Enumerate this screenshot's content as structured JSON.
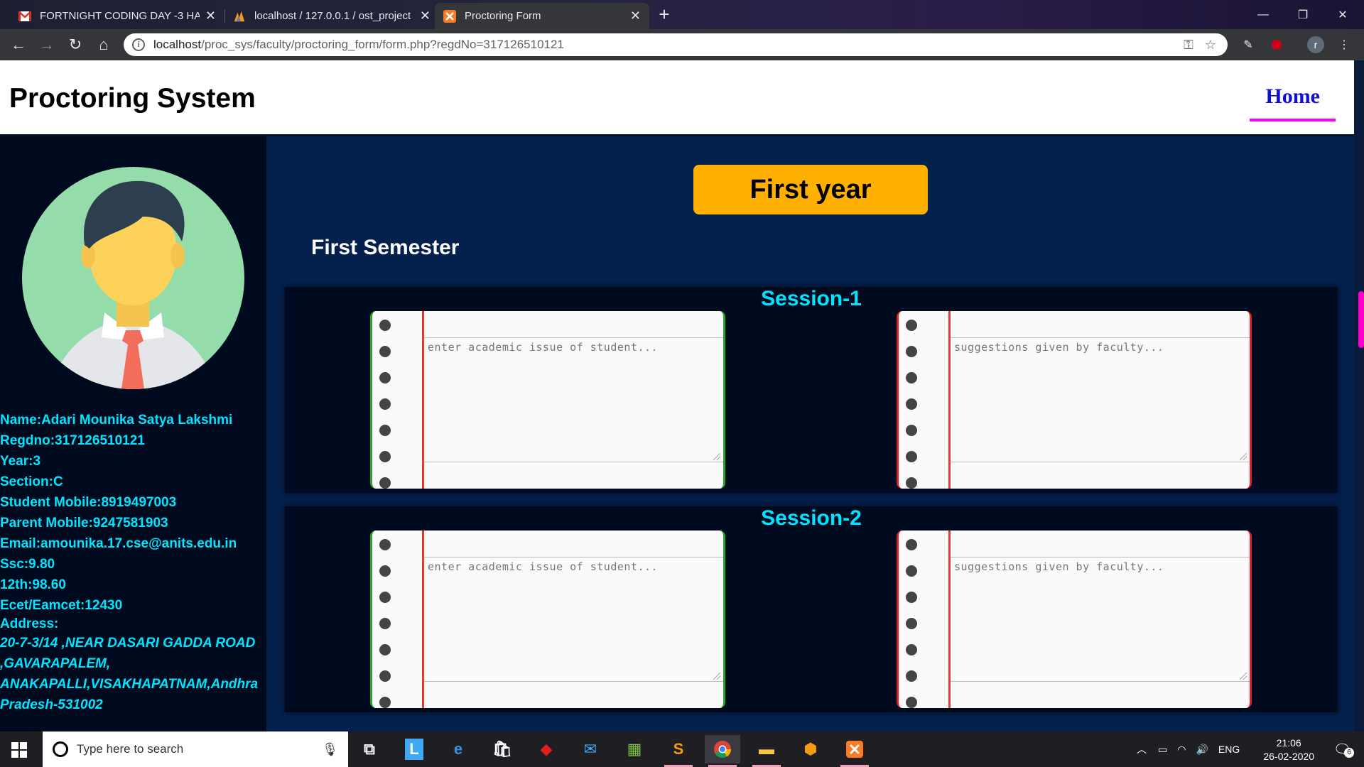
{
  "browser": {
    "tabs": [
      {
        "title": "FORTNIGHT CODING DAY -3 HAC",
        "favicon": "gmail-icon",
        "active": false
      },
      {
        "title": "localhost / 127.0.0.1 / ost_project",
        "favicon": "phpmyadmin-icon",
        "active": false
      },
      {
        "title": "Proctoring Form",
        "favicon": "xampp-icon",
        "active": true
      }
    ],
    "url_host": "localhost",
    "url_path": "/proc_sys/faculty/proctoring_form/form.php?regdNo=317126510121",
    "profile_initial": "r"
  },
  "header": {
    "brand": "Proctoring System",
    "home_link": "Home"
  },
  "student": {
    "name": "Name:Adari Mounika Satya Lakshmi",
    "regdno": "Regdno:317126510121",
    "year": "Year:3",
    "section": "Section:C",
    "student_mobile": "Student Mobile:8919497003",
    "parent_mobile": "Parent Mobile:9247581903",
    "email": "Email:amounika.17.cse@anits.edu.in",
    "ssc": "Ssc:9.80",
    "twelfth": "12th:98.60",
    "ecet": "Ecet/Eamcet:12430",
    "address_label": "Address:",
    "address": "20-7-3/14 ,NEAR DASARI GADDA ROAD ,GAVARAPALEM, ANAKAPALLI,VISAKHAPATNAM,Andhra Pradesh-531002"
  },
  "main": {
    "year_button": "First year",
    "semester_title": "First Semester",
    "sessions": [
      {
        "title": "Session-1",
        "issue_placeholder": "enter academic issue of student...",
        "suggestion_placeholder": "suggestions given by faculty..."
      },
      {
        "title": "Session-2",
        "issue_placeholder": "enter academic issue of student...",
        "suggestion_placeholder": "suggestions given by faculty..."
      }
    ]
  },
  "taskbar": {
    "search_placeholder": "Type here to search",
    "language": "ENG",
    "time": "21:06",
    "date": "26-02-2020",
    "notification_count": "6"
  },
  "colors": {
    "accent_cyan": "#00e5ff",
    "year_button": "#ffb000",
    "home_underline": "#ff00ff",
    "page_bg": "#04204d"
  }
}
